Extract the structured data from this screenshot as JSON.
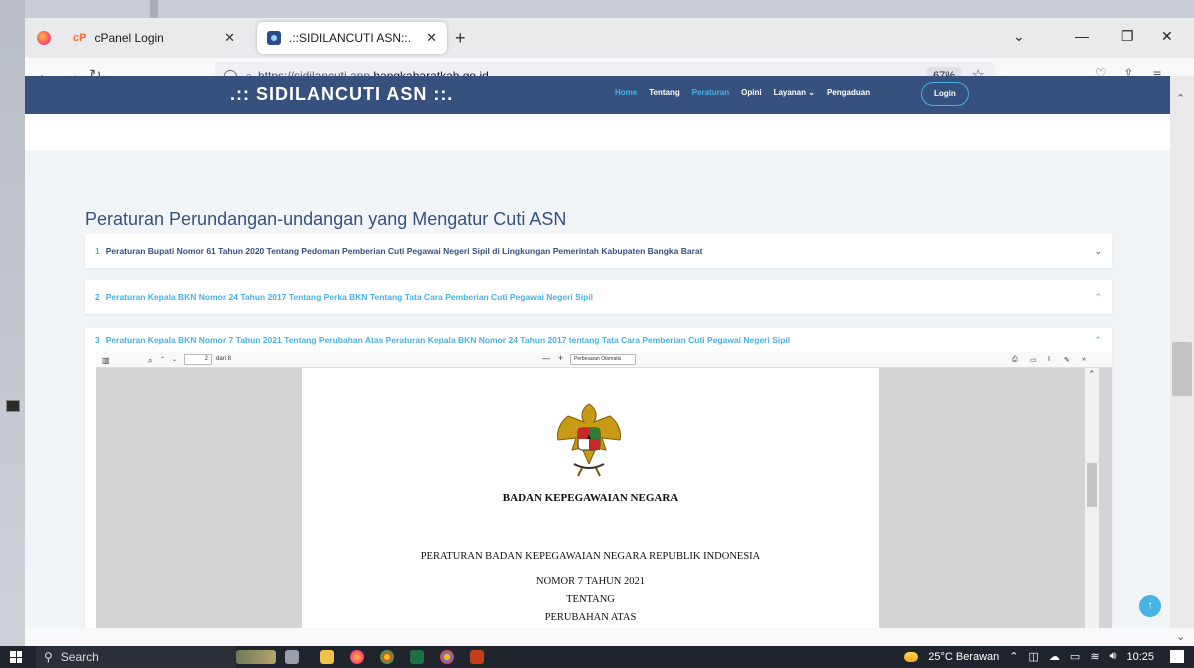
{
  "browser": {
    "tabs": [
      {
        "label": "cPanel Login",
        "favicon": "cpanel-icon",
        "active": false
      },
      {
        "label": ".::SIDILANCUTI ASN::.",
        "favicon": "site-icon",
        "active": true
      }
    ],
    "url_prefix": "https://sidilancuti.app.",
    "url_host": "bangkabaratkab.go.id",
    "zoom": "67%"
  },
  "site": {
    "logo": ".:: SIDILANCUTI ASN ::.",
    "menu": [
      "Home",
      "Tentang",
      "Peraturan",
      "Opini",
      "Layanan",
      "Pengaduan"
    ],
    "login": "Login",
    "section_title": "Peraturan Perundangan-undangan yang Mengatur Cuti ASN",
    "accordion": [
      {
        "num": "1",
        "text": "Peraturan Bupati Nomor 61 Tahun 2020 Tentang Pedoman Pemberian Cuti Pegawai Negeri Sipil di Lingkungan Pemerintah Kabupaten Bangka Barat",
        "chevron": "⌄"
      },
      {
        "num": "2",
        "text": "Peraturan Kepala BKN Nomor 24 Tahun 2017 Tentang Perka BKN Tentang Tata Cara Pemberian Cuti Pegawai Negeri Sipil",
        "chevron": "⌃"
      },
      {
        "num": "3",
        "text": "Peraturan Kepala BKN Nomor 7 Tahun 2021 Tentang Perubahan Atas Peraturan Kepala BKN Nomor 24 Tahun 2017 tentang Tata Cara Pemberian Cuti Pegawai Negeri Sipil",
        "chevron": "⌃"
      }
    ]
  },
  "pdf": {
    "page_input": "2",
    "page_total": "dari 8",
    "zoom_select": "Perbesaran Otomatis",
    "agency": "BADAN KEPEGAWAIAN NEGARA",
    "lines": [
      "PERATURAN BADAN KEPEGAWAIAN NEGARA REPUBLIK INDONESIA",
      "NOMOR 7 TAHUN 2021",
      "TENTANG",
      "PERUBAHAN ATAS"
    ]
  },
  "taskbar": {
    "search": "Search",
    "weather": "25°C  Berawan",
    "time": "10:25"
  },
  "colors": {
    "header": "#37517e",
    "accent": "#47b2e4",
    "page_bg": "#f2f5f8"
  }
}
